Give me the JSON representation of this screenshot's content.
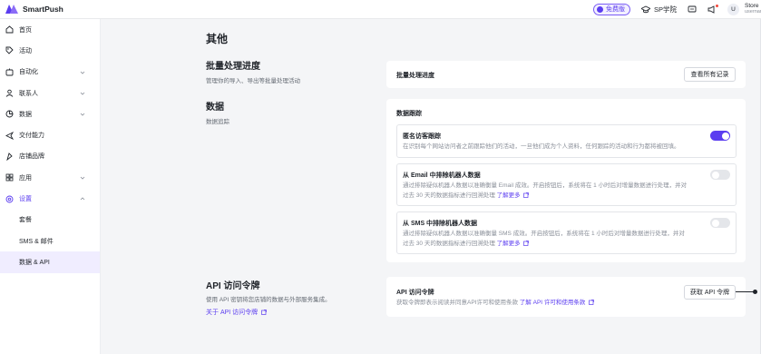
{
  "app": {
    "name": "SmartPush"
  },
  "topbar": {
    "free_badge": "免费版",
    "academy": "SP学院",
    "account_name": "Store",
    "account_sub": "username",
    "avatar_initial": "U"
  },
  "sidebar": {
    "items": [
      {
        "label": "首页",
        "icon": "home-icon"
      },
      {
        "label": "活动",
        "icon": "tag-icon"
      },
      {
        "label": "自动化",
        "icon": "automation-icon",
        "expandable": true
      },
      {
        "label": "联系人",
        "icon": "contacts-icon",
        "expandable": true
      },
      {
        "label": "数据",
        "icon": "analytics-icon",
        "expandable": true
      },
      {
        "label": "交付能力",
        "icon": "send-icon"
      },
      {
        "label": "店铺品牌",
        "icon": "brand-icon"
      },
      {
        "label": "应用",
        "icon": "apps-icon",
        "expandable": true
      },
      {
        "label": "设置",
        "icon": "settings-icon",
        "expandable": true,
        "expanded": true
      }
    ],
    "sub_items": [
      {
        "label": "套餐"
      },
      {
        "label": "SMS & 邮件"
      },
      {
        "label": "数据 & API",
        "selected": true
      }
    ]
  },
  "main": {
    "page_title": "其他",
    "batch": {
      "title": "批量处理进度",
      "desc": "管理你的导入、导出等批量处理活动",
      "card_label": "批量处理进度",
      "button": "查看所有记录"
    },
    "data": {
      "title": "数据",
      "desc": "数据追踪",
      "card_label": "数据跟踪",
      "rows": [
        {
          "title": "匿名访客跟踪",
          "desc_1": "在识别每个网站访问者之前跟踪他们的活动，一旦他们成为个人资料，任何跟踪的活动和行为都将被回填。",
          "desc_2": "",
          "learn_more": "",
          "toggle_on": true
        },
        {
          "title": "从 Email 中排除机器人数据",
          "desc_1": "通过排除疑似机器人数据以准确衡量 Email 成效。开启按钮后，系统将在 1 小时后对增量数据进行处理，并对",
          "desc_2": "过去 30 天的数据指标进行回溯处理",
          "learn_more": "了解更多",
          "toggle_on": false
        },
        {
          "title": "从 SMS 中排除机器人数据",
          "desc_1": "通过排除疑似机器人数据以准确衡量 SMS 成效。开启按钮后，系统将在 1 小时后对增量数据进行处理，并对",
          "desc_2": "过去 30 天的数据指标进行回溯处理",
          "learn_more": "了解更多",
          "toggle_on": false
        }
      ]
    },
    "api": {
      "title": "API 访问令牌",
      "desc": "使用 API 密钥将您店铺的数据与外部服务集成。",
      "link": "关于 API 访问令牌",
      "card_label": "API 访问令牌",
      "card_desc": "获取令牌即表示阅读并同意API许可和使用条款",
      "card_link": "了解 API 许可和使用条款",
      "button": "获取 API 令牌"
    }
  },
  "colors": {
    "accent": "#5b3df0",
    "background": "#f4f5f7"
  }
}
